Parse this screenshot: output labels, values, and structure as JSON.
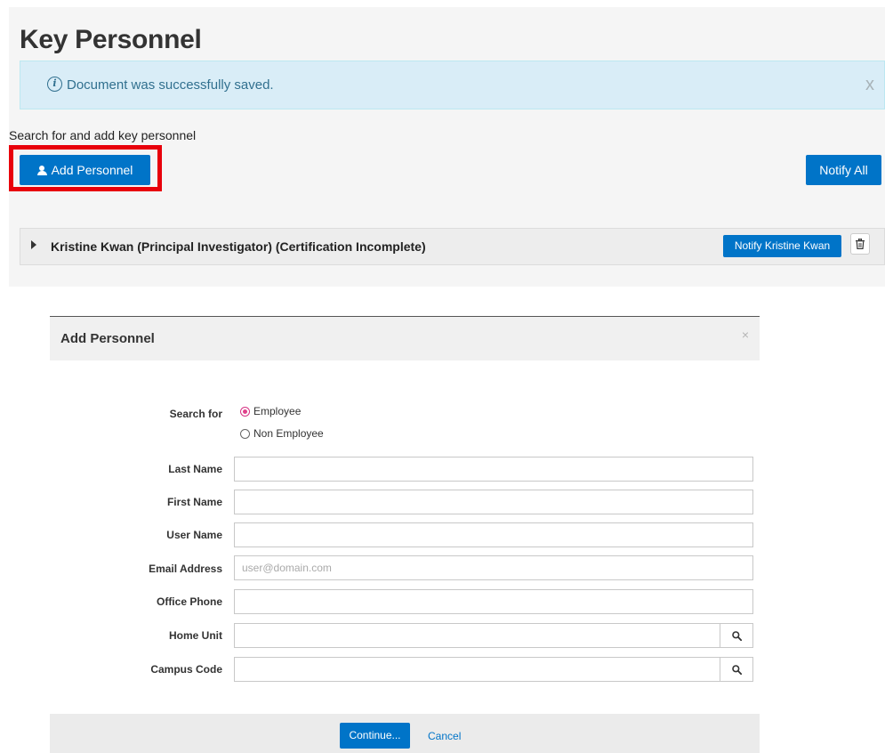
{
  "page": {
    "title": "Key Personnel"
  },
  "alert": {
    "message": "Document was successfully saved.",
    "close_glyph": "x",
    "icon": "info-circle-icon"
  },
  "personnel": {
    "hint": "Search for and add key personnel",
    "add_button": "Add Personnel",
    "notify_all_button": "Notify All",
    "rows": [
      {
        "name": "Kristine Kwan (Principal Investigator) (Certification Incomplete)",
        "notify_button": "Notify Kristine Kwan"
      }
    ]
  },
  "modal": {
    "title": "Add Personnel",
    "close_glyph": "×",
    "search_for": {
      "label": "Search for",
      "options": [
        "Employee",
        "Non Employee"
      ],
      "selected": "Employee"
    },
    "fields": {
      "last_name": {
        "label": "Last Name",
        "value": ""
      },
      "first_name": {
        "label": "First Name",
        "value": ""
      },
      "user_name": {
        "label": "User Name",
        "value": ""
      },
      "email": {
        "label": "Email Address",
        "value": "",
        "placeholder": "user@domain.com"
      },
      "office_phone": {
        "label": "Office Phone",
        "value": ""
      },
      "home_unit": {
        "label": "Home Unit",
        "value": ""
      },
      "campus_code": {
        "label": "Campus Code",
        "value": ""
      }
    },
    "continue_button": "Continue...",
    "cancel_link": "Cancel"
  },
  "colors": {
    "primary_button": "#0074c8",
    "alert_bg": "#d9edf7",
    "alert_text": "#31708f",
    "highlight": "#e8000b"
  }
}
